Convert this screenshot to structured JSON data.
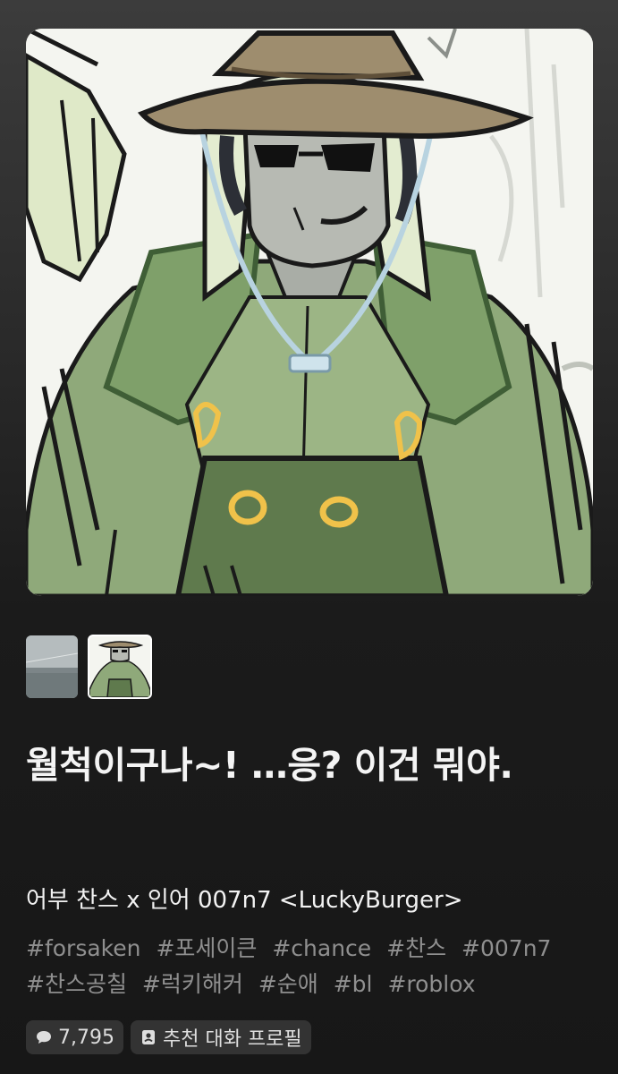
{
  "hero": {
    "icon": "character-illustration"
  },
  "gallery": {
    "thumbnails": [
      {
        "icon": "sea-landscape-thumbnail",
        "selected": false
      },
      {
        "icon": "character-thumbnail",
        "selected": true
      }
    ]
  },
  "title": "월척이구나~! …응? 이건 뭐야.",
  "subtitle": "어부 찬스 x 인어 007n7 <LuckyBurger>",
  "tags": [
    "#forsaken",
    "#포세이큰",
    "#chance",
    "#찬스",
    "#007n7",
    "#찬스공칠",
    "#럭키해커",
    "#순애",
    "#bl",
    "#roblox"
  ],
  "stats": {
    "comment_count": "7,795",
    "comment_icon": "speech-bubble-icon",
    "profile_label": "추천 대화 프로필",
    "profile_icon": "profile-card-icon"
  },
  "colors": {
    "background": "#171717",
    "text": "#f0f0f0",
    "tag_text": "#8f8f8f",
    "badge_bg": "#333333"
  }
}
